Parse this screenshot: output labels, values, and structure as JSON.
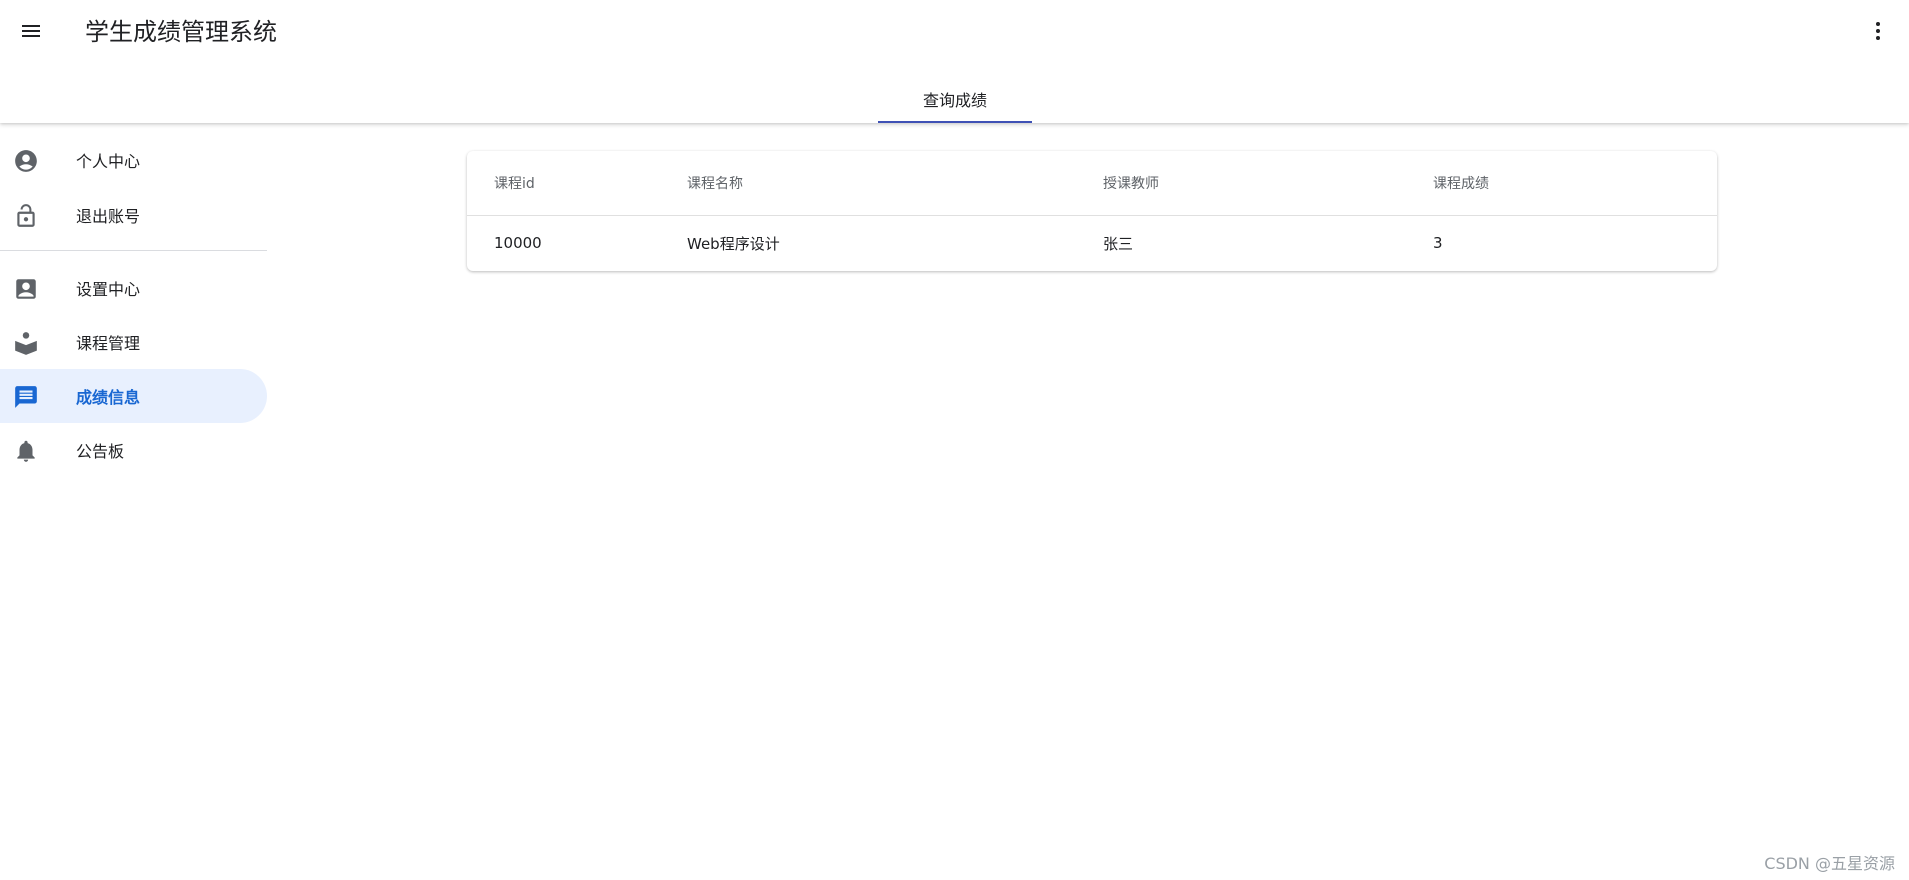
{
  "header": {
    "title": "学生成绩管理系统",
    "menu_icon": "menu-icon",
    "more_icon": "more-vert-icon"
  },
  "tabs": [
    {
      "label": "查询成绩",
      "active": true
    }
  ],
  "sidebar": {
    "items": [
      {
        "label": "个人中心",
        "icon": "account-circle-icon",
        "active": false
      },
      {
        "label": "退出账号",
        "icon": "lock-open-icon",
        "active": false
      },
      {
        "label": "设置中心",
        "icon": "contact-icon",
        "active": false
      },
      {
        "label": "课程管理",
        "icon": "book-reader-icon",
        "active": false
      },
      {
        "label": "成绩信息",
        "icon": "message-icon",
        "active": true
      },
      {
        "label": "公告板",
        "icon": "bell-icon",
        "active": false
      }
    ]
  },
  "table": {
    "columns": [
      "课程id",
      "课程名称",
      "授课教师",
      "课程成绩"
    ],
    "rows": [
      [
        "10000",
        "Web程序设计",
        "张三",
        "3"
      ]
    ]
  },
  "watermark": "CSDN @五星资源",
  "colors": {
    "accent": "#1967d2",
    "active_bg": "#e8f0fe",
    "tab_indicator": "#3f51b5",
    "icon": "#5f6368"
  }
}
